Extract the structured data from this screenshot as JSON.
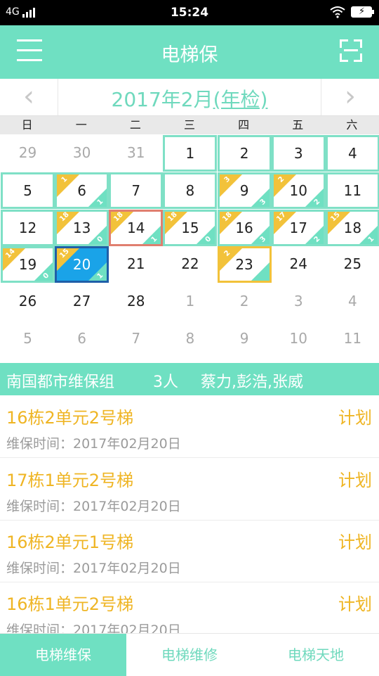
{
  "status_bar": {
    "network": "4G",
    "time": "15:24"
  },
  "app_bar": {
    "title": "电梯保"
  },
  "calendar": {
    "month_title": "2017年2月",
    "month_link": "(年检)",
    "weekdays": [
      "日",
      "一",
      "二",
      "三",
      "四",
      "五",
      "六"
    ],
    "days": [
      {
        "d": "29",
        "other": true
      },
      {
        "d": "30",
        "other": true
      },
      {
        "d": "31",
        "other": true
      },
      {
        "d": "1",
        "boxed": true
      },
      {
        "d": "2",
        "boxed": true
      },
      {
        "d": "3",
        "boxed": true
      },
      {
        "d": "4",
        "boxed": true
      },
      {
        "d": "5",
        "boxed": true
      },
      {
        "d": "6",
        "boxed": true,
        "tl": "1",
        "br": "1"
      },
      {
        "d": "7",
        "boxed": true
      },
      {
        "d": "8",
        "boxed": true
      },
      {
        "d": "9",
        "boxed": true,
        "tl": "3",
        "br": "3"
      },
      {
        "d": "10",
        "boxed": true,
        "tl": "2",
        "br": "2"
      },
      {
        "d": "11",
        "boxed": true
      },
      {
        "d": "12",
        "boxed": true
      },
      {
        "d": "13",
        "boxed": true,
        "tl": "18",
        "br": "0"
      },
      {
        "d": "14",
        "boxed": true,
        "today": true,
        "tl": "18",
        "br": "1"
      },
      {
        "d": "15",
        "boxed": true,
        "tl": "18",
        "br": "0"
      },
      {
        "d": "16",
        "boxed": true,
        "tl": "18",
        "br": "3"
      },
      {
        "d": "17",
        "boxed": true,
        "tl": "17",
        "br": "2"
      },
      {
        "d": "18",
        "boxed": true,
        "tl": "15",
        "br": "1"
      },
      {
        "d": "19",
        "boxed": true,
        "tl": "14",
        "br": "0"
      },
      {
        "d": "20",
        "boxed": true,
        "selected": true,
        "tl": "15",
        "br": "1"
      },
      {
        "d": "21"
      },
      {
        "d": "22"
      },
      {
        "d": "23",
        "boxed": true,
        "highlight": true,
        "tl": "2",
        "br": ""
      },
      {
        "d": "24"
      },
      {
        "d": "25"
      },
      {
        "d": "26"
      },
      {
        "d": "27"
      },
      {
        "d": "28"
      },
      {
        "d": "1",
        "other": true
      },
      {
        "d": "2",
        "other": true
      },
      {
        "d": "3",
        "other": true
      },
      {
        "d": "4",
        "other": true
      },
      {
        "d": "5",
        "other": true
      },
      {
        "d": "6",
        "other": true
      },
      {
        "d": "7",
        "other": true
      },
      {
        "d": "8",
        "other": true
      },
      {
        "d": "9",
        "other": true
      },
      {
        "d": "10",
        "other": true
      },
      {
        "d": "11",
        "other": true
      }
    ]
  },
  "team": {
    "name": "南国都市维保组",
    "count": "3人",
    "members": "蔡力,彭浩,张威"
  },
  "tasks": [
    {
      "title": "16栋2单元2号梯",
      "status": "计划",
      "time": "维保时间：2017年02月20日"
    },
    {
      "title": "17栋1单元2号梯",
      "status": "计划",
      "time": "维保时间：2017年02月20日"
    },
    {
      "title": "16栋2单元1号梯",
      "status": "计划",
      "time": "维保时间：2017年02月20日"
    },
    {
      "title": "16栋1单元2号梯",
      "status": "计划",
      "time": "维保时间：2017年02月20日"
    }
  ],
  "bottom_nav": {
    "tab1": "电梯维保",
    "tab2": "电梯维修",
    "tab3": "电梯天地"
  },
  "colors": {
    "accent": "#6fe0c2",
    "yellow": "#f2c23a",
    "selected": "#1aa3e8",
    "today_border": "#e07f6f"
  },
  "icons": {
    "menu": "menu-icon",
    "scan": "scan-icon",
    "prev": "chevron-left-icon",
    "next": "chevron-right-icon"
  }
}
